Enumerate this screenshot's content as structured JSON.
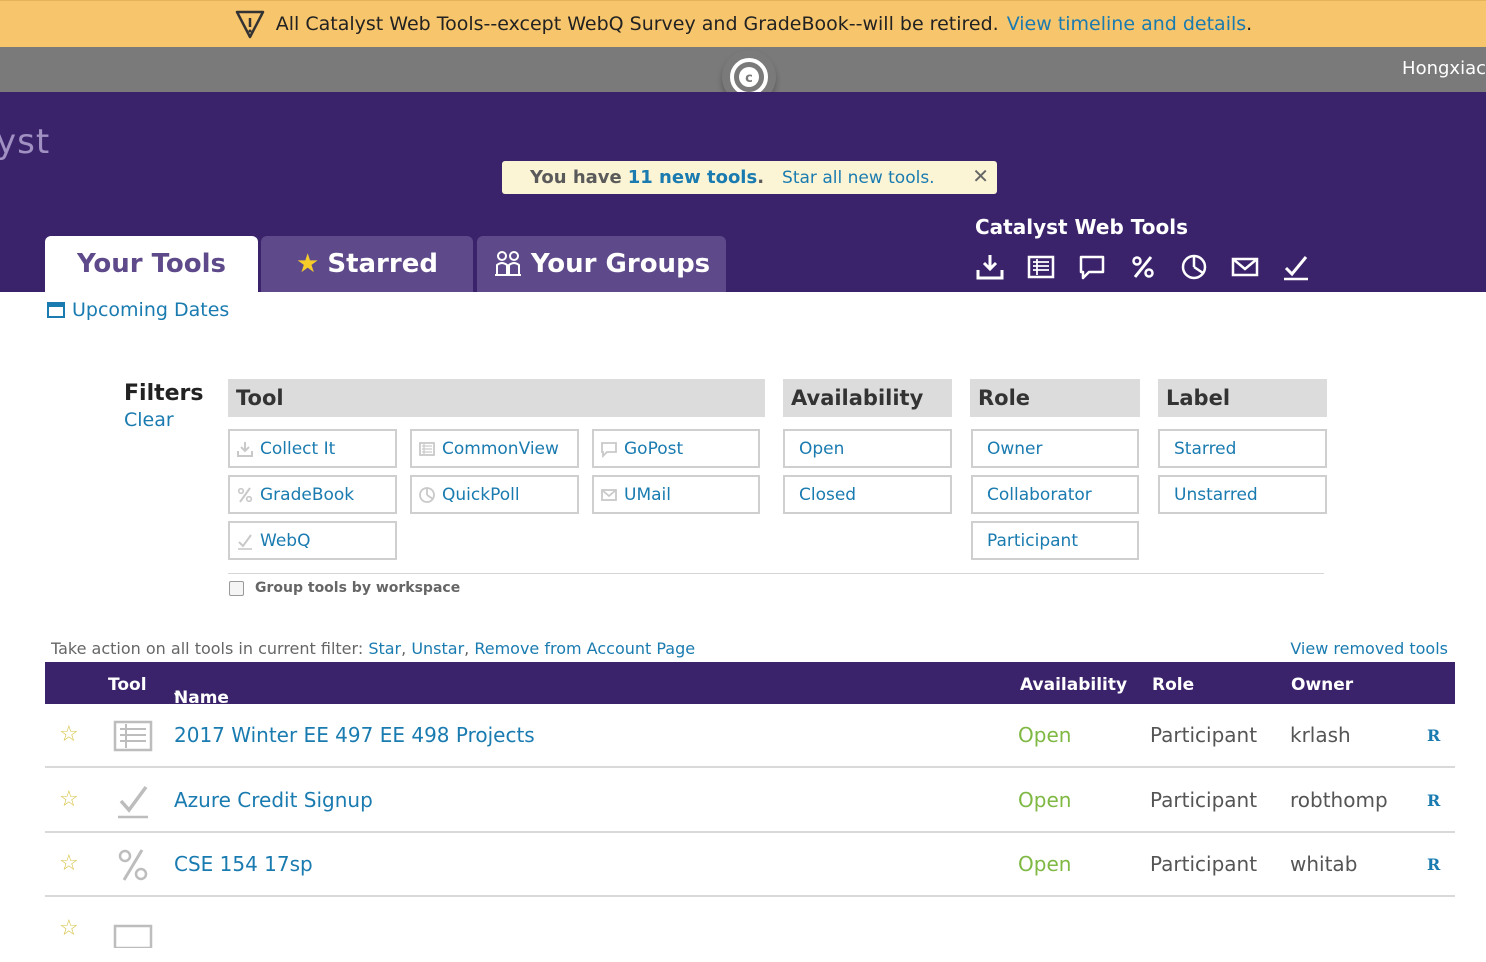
{
  "banner": {
    "message": "All Catalyst Web Tools--except WebQ Survey and GradeBook--will be retired.",
    "link": "View timeline and details",
    "period": "."
  },
  "topbar": {
    "user": "Hongxiac"
  },
  "header": {
    "brand": "yst",
    "new_tools": {
      "prefix": "You have",
      "count": "11 new tools",
      "suffix": ".",
      "star_all": "Star all new tools.",
      "close": "✕"
    },
    "cwt_title": "Catalyst Web Tools",
    "cwt_icons": [
      "download-icon",
      "commonview-icon",
      "gopost-icon",
      "percent-icon",
      "quickpoll-icon",
      "mail-icon",
      "check-icon"
    ]
  },
  "tabs": [
    {
      "label": "Your Tools",
      "active": true
    },
    {
      "label": "Starred",
      "icon": "star-icon"
    },
    {
      "label": "Your Groups",
      "icon": "group-icon"
    }
  ],
  "upcoming": "Upcoming Dates",
  "filters": {
    "title": "Filters",
    "clear": "Clear",
    "tool_header": "Tool",
    "availability_header": "Availability",
    "role_header": "Role",
    "label_header": "Label",
    "tools": [
      "Collect It",
      "CommonView",
      "GoPost",
      "GradeBook",
      "QuickPoll",
      "UMail",
      "WebQ"
    ],
    "availability": [
      "Open",
      "Closed"
    ],
    "roles": [
      "Owner",
      "Collaborator",
      "Participant"
    ],
    "labels": [
      "Starred",
      "Unstarred"
    ],
    "group_by": "Group tools by workspace"
  },
  "actions": {
    "prefix": "Take action on all tools in current filter:",
    "star": "Star",
    "unstar": "Unstar",
    "remove": "Remove from Account Page",
    "comma": ",",
    "view_removed": "View removed tools"
  },
  "table": {
    "headers": {
      "tool": "Tool",
      "name": "Name",
      "sort": "▾",
      "availability": "Availability",
      "role": "Role",
      "owner": "Owner"
    },
    "rows": [
      {
        "name": "2017 Winter EE 497 EE 498 Projects",
        "availability": "Open",
        "role": "Participant",
        "owner": "krlash",
        "r": "R",
        "tool_icon": "commonview-icon"
      },
      {
        "name": "Azure Credit Signup",
        "availability": "Open",
        "role": "Participant",
        "owner": "robthomp",
        "r": "R",
        "tool_icon": "webq-icon"
      },
      {
        "name": "CSE 154 17sp",
        "availability": "Open",
        "role": "Participant",
        "owner": "whitab",
        "r": "R",
        "tool_icon": "gradebook-icon"
      }
    ]
  },
  "colors": {
    "purple": "#3b236c",
    "tab_inactive": "#5e4a8a",
    "banner": "#f7c56b",
    "link": "#1a7bb0",
    "open": "#7fb843"
  }
}
